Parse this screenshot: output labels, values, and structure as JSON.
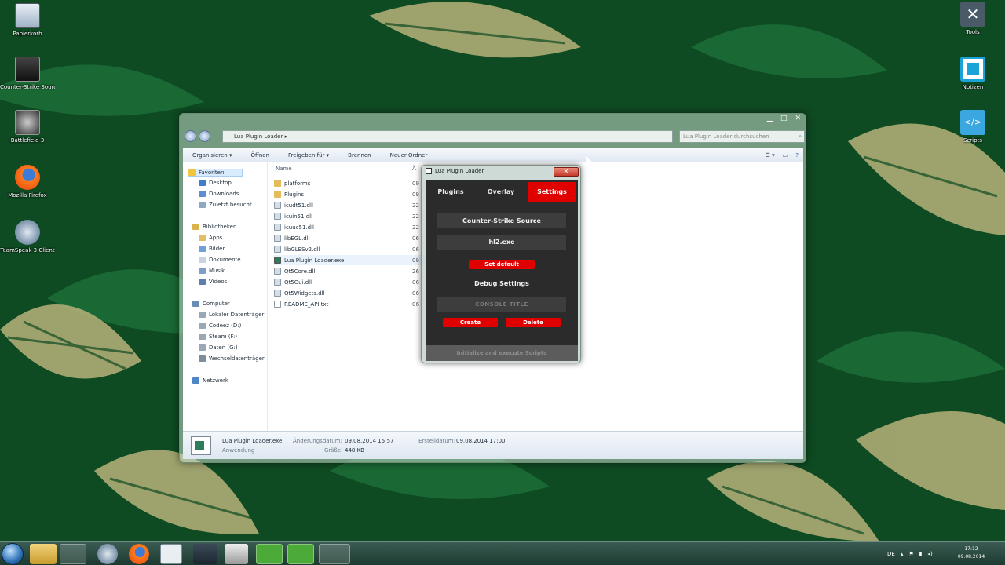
{
  "desktop": {
    "left_icons": [
      {
        "name": "recycle-bin",
        "label": "Papierkorb",
        "icon": "recycle-bin-icon"
      },
      {
        "name": "game-shortcut-1",
        "label": "Counter-Strike Source",
        "icon": "game-icon"
      },
      {
        "name": "game-shortcut-2",
        "label": "Battlefield 3",
        "icon": "game-icon"
      },
      {
        "name": "firefox",
        "label": "Mozilla Firefox",
        "icon": "firefox-icon"
      },
      {
        "name": "teamspeak",
        "label": "TeamSpeak 3 Client",
        "icon": "teamspeak-icon"
      }
    ],
    "right_icons": [
      {
        "name": "tools",
        "label": "Tools",
        "icon": "tools-icon"
      },
      {
        "name": "notes",
        "label": "Notizen",
        "icon": "notes-icon"
      },
      {
        "name": "code",
        "label": "Scripts",
        "icon": "code-icon"
      }
    ]
  },
  "explorer": {
    "address": "Lua Plugin Loader",
    "search_placeholder": "Lua Plugin Loader durchsuchen",
    "toolbar": {
      "organize": "Organisieren ▾",
      "open": "Öffnen",
      "share": "Freigeben für ▾",
      "burn": "Brennen",
      "new_folder": "Neuer Ordner"
    },
    "nav": {
      "favorites": "Favoriten",
      "desktop": "Desktop",
      "downloads": "Downloads",
      "recent": "Zuletzt besucht",
      "libraries": "Bibliotheken",
      "apps": "Apps",
      "pictures": "Bilder",
      "documents": "Dokumente",
      "music": "Musik",
      "videos": "Videos",
      "computer": "Computer",
      "local_disk": "Lokaler Datenträger",
      "drive_d": "Codeez (D:)",
      "drive_f": "Steam (F:)",
      "drive_g": "Daten (G:)",
      "removable": "Wechseldatenträger",
      "network": "Netzwerk"
    },
    "column_name": "Name",
    "column_date": "Ä",
    "files": [
      {
        "name": "platforms",
        "date": "09",
        "type": "folder"
      },
      {
        "name": "Plugins",
        "date": "09",
        "type": "folder"
      },
      {
        "name": "icudt51.dll",
        "date": "22",
        "type": "dll"
      },
      {
        "name": "icuin51.dll",
        "date": "22",
        "type": "dll"
      },
      {
        "name": "icuuc51.dll",
        "date": "22",
        "type": "dll"
      },
      {
        "name": "libEGL.dll",
        "date": "06",
        "type": "dll"
      },
      {
        "name": "libGLESv2.dll",
        "date": "06",
        "type": "dll"
      },
      {
        "name": "Lua Plugin Loader.exe",
        "date": "09",
        "type": "exe"
      },
      {
        "name": "Qt5Core.dll",
        "date": "26",
        "type": "dll"
      },
      {
        "name": "Qt5Gui.dll",
        "date": "06",
        "type": "dll"
      },
      {
        "name": "Qt5Widgets.dll",
        "date": "06",
        "type": "dll"
      },
      {
        "name": "README_API.txt",
        "date": "06",
        "type": "txt"
      }
    ],
    "status": {
      "filename": "Lua Plugin Loader.exe",
      "type": "Anwendung",
      "modified_label": "Änderungsdatum:",
      "modified_value": "09.08.2014 15:57",
      "size_label": "Größe:",
      "size_value": "448 KB",
      "created_label": "Erstelldatum:",
      "created_value": "09.08.2014 17:00"
    }
  },
  "lua_loader": {
    "title": "Lua Plugin Loader",
    "tabs": [
      "Plugins",
      "Overlay",
      "Settings"
    ],
    "active_tab": "Settings",
    "game_name": "Counter-Strike Source",
    "process_name": "hl2.exe",
    "set_default_label": "Set default",
    "debug_label": "Debug Settings",
    "console_title_placeholder": "CONSOLE TITLE",
    "create_label": "Create",
    "delete_label": "Delete",
    "footer": "Initialize and execute Scripts",
    "close_glyph": "✕"
  },
  "taskbar": {
    "language": "DE",
    "time": "17:12",
    "date": "09.08.2014"
  },
  "colors": {
    "accent_red": "#e00000",
    "loader_bg": "#2b2b2b",
    "wallpaper_green": "#0e4a22"
  }
}
